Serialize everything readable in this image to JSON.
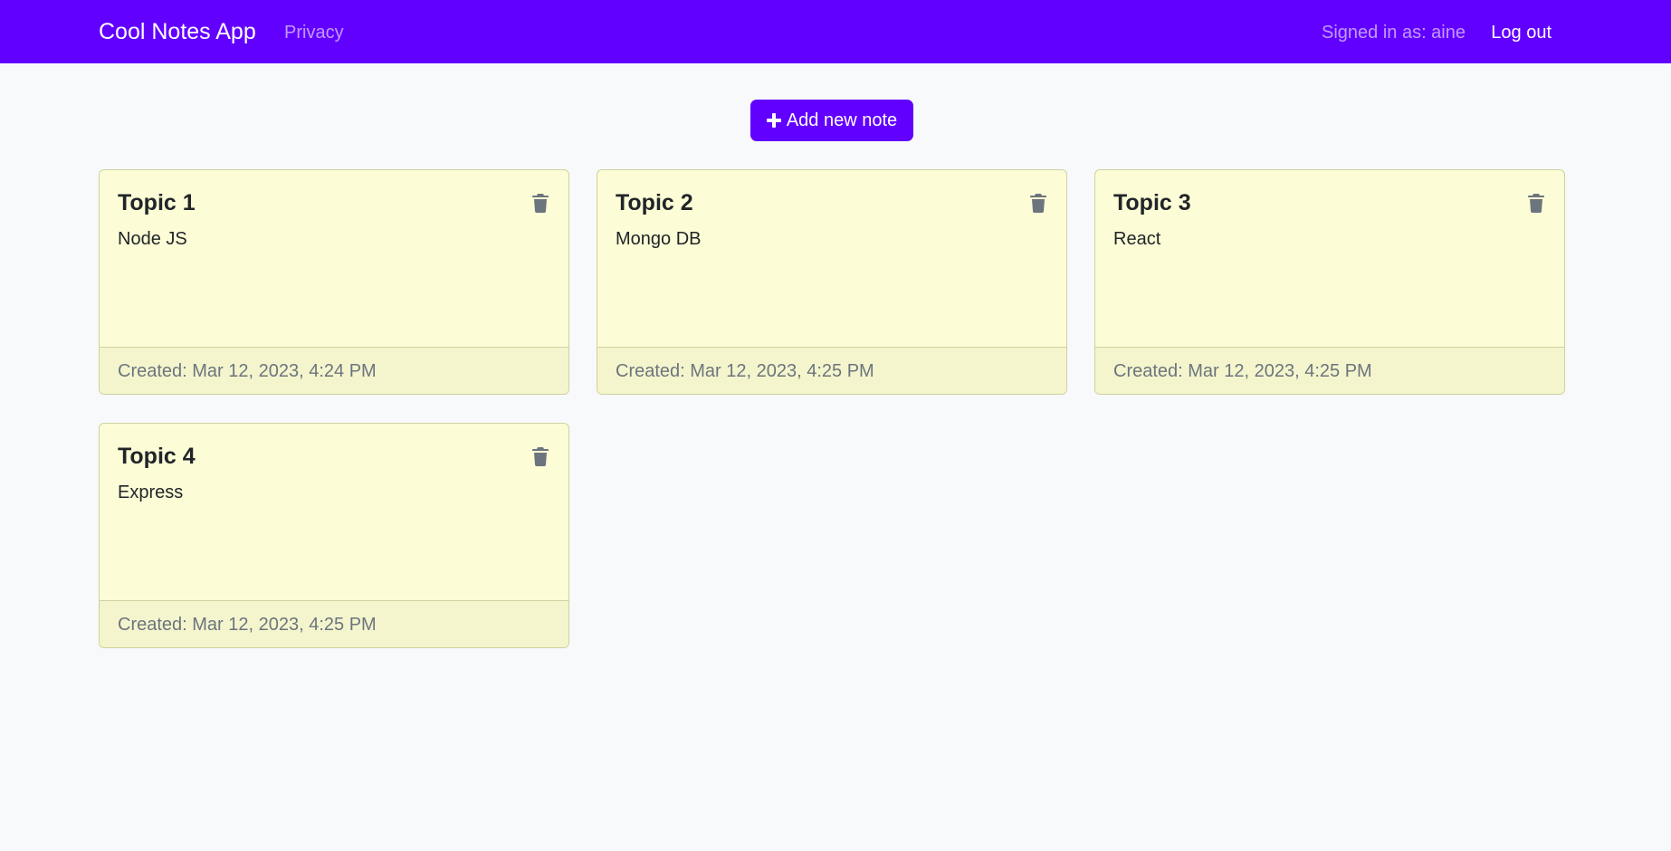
{
  "navbar": {
    "brand": "Cool Notes App",
    "privacy_link": "Privacy",
    "signed_in_text": "Signed in as: aine",
    "logout_label": "Log out",
    "background_color": "#6200ff"
  },
  "main": {
    "add_button_label": "Add new note",
    "add_button_icon": "plus-icon",
    "notes": [
      {
        "title": "Topic 1",
        "text": "Node JS",
        "created": "Created: Mar 12, 2023, 4:24 PM",
        "delete_icon": "trash-icon"
      },
      {
        "title": "Topic 2",
        "text": "Mongo DB",
        "created": "Created: Mar 12, 2023, 4:25 PM",
        "delete_icon": "trash-icon"
      },
      {
        "title": "Topic 3",
        "text": "React",
        "created": "Created: Mar 12, 2023, 4:25 PM",
        "delete_icon": "trash-icon"
      },
      {
        "title": "Topic 4",
        "text": "Express",
        "created": "Created: Mar 12, 2023, 4:25 PM",
        "delete_icon": "trash-icon"
      }
    ],
    "card_color": "#fcfdd6",
    "card_footer_color": "#f4f5cd"
  }
}
